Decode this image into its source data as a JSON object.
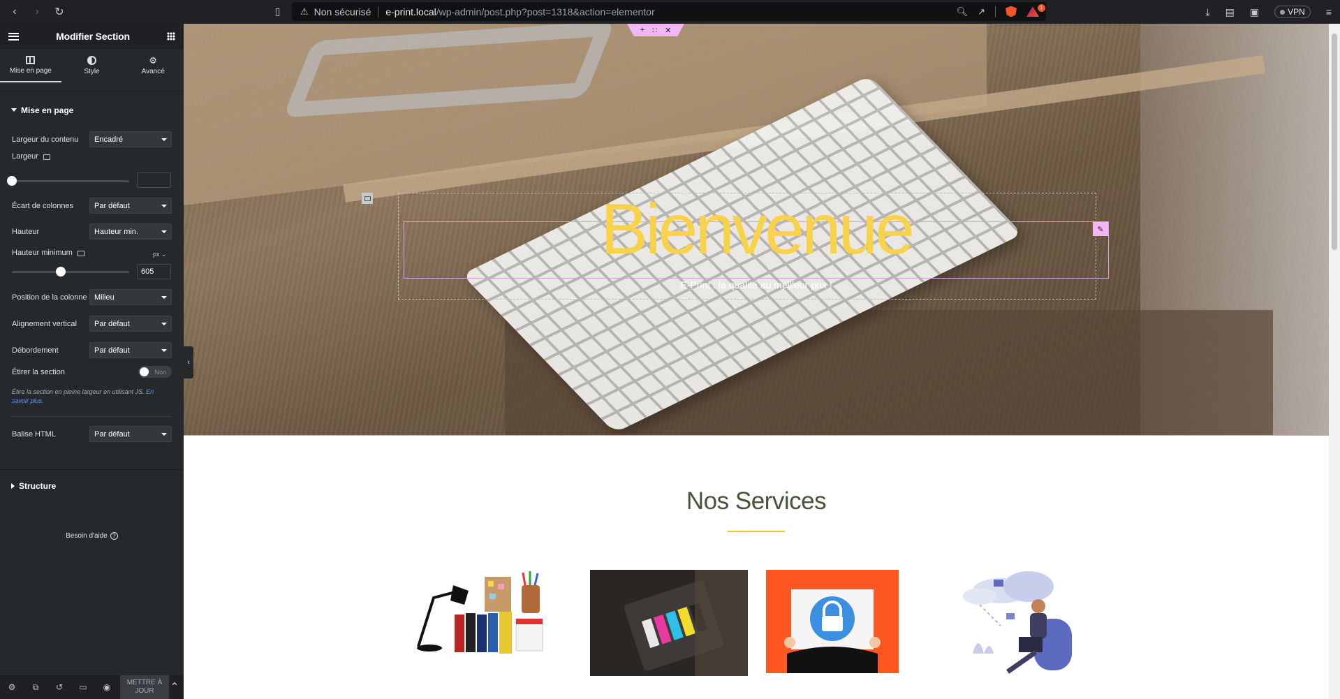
{
  "browser": {
    "security_label": "Non sécurisé",
    "url_host": "e-print.local",
    "url_path": "/wp-admin/post.php?post=1318&action=elementor",
    "vpn_label": "VPN",
    "brave_badge": "1"
  },
  "panel": {
    "title": "Modifier Section",
    "tabs": [
      {
        "label": "Mise en page",
        "icon": "layout-icon"
      },
      {
        "label": "Style",
        "icon": "contrast-icon"
      },
      {
        "label": "Avancé",
        "icon": "gear-icon"
      }
    ],
    "section_title": "Mise en page",
    "controls": {
      "content_width_label": "Largeur du contenu",
      "content_width_value": "Encadré",
      "width_label": "Largeur",
      "gap_label": "Écart de colonnes",
      "gap_value": "Par défaut",
      "height_label": "Hauteur",
      "height_value": "Hauteur min.",
      "min_height_label": "Hauteur minimum",
      "min_height_unit": "px",
      "min_height_value": "605",
      "column_position_label": "Position de la colonne",
      "column_position_value": "Milieu",
      "vertical_align_label": "Alignement vertical",
      "vertical_align_value": "Par défaut",
      "overflow_label": "Débordement",
      "overflow_value": "Par défaut",
      "stretch_label": "Étirer la section",
      "stretch_toggle": "Non",
      "stretch_desc": "Étire la section en pleine largeur en utilisant JS.",
      "stretch_link": "En savoir plus",
      "html_tag_label": "Balise HTML",
      "html_tag_value": "Par défaut"
    },
    "structure_title": "Structure",
    "help_label": "Besoin d'aide",
    "update_label": "METTRE À JOUR"
  },
  "canvas": {
    "hero_title": "Bienvenue",
    "hero_subtitle": "E-Print : la qualité au meilleur prix !",
    "services_title": "Nos Services"
  },
  "colors": {
    "hero_title": "#f8d34a",
    "accent_line": "#f2c22e",
    "services_title": "#45543a",
    "editor_outline": "#d79ee0"
  }
}
